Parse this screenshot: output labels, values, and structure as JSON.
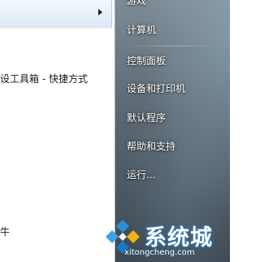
{
  "left_pane": {
    "items": [
      {
        "label": "设工具箱 - 快捷方式"
      },
      {
        "label": "牛"
      }
    ]
  },
  "right_pane": {
    "items": [
      {
        "label": "游戏"
      },
      {
        "label": "计算机"
      },
      {
        "label": "控制面板"
      },
      {
        "label": "设备和打印机"
      },
      {
        "label": "默认程序"
      },
      {
        "label": "帮助和支持"
      },
      {
        "label": "运行..."
      }
    ]
  },
  "watermark": {
    "brand": "系统城",
    "url": "xitongcheng.com"
  },
  "colors": {
    "accent_blue": "#2a7ec2",
    "right_pane_bg": "#5d6a74"
  }
}
